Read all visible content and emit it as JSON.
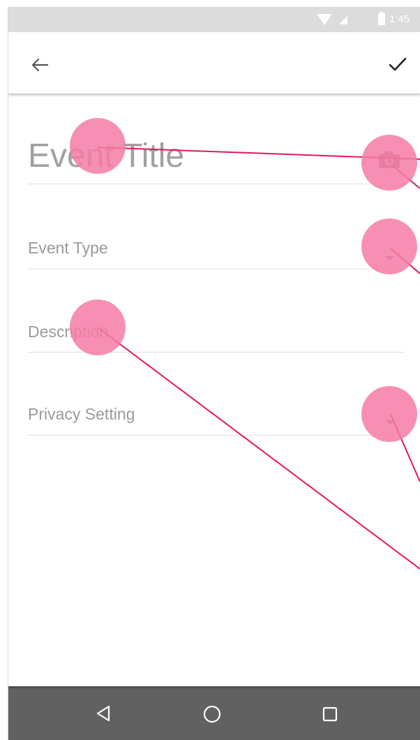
{
  "status_bar": {
    "time": "1:45"
  },
  "app_bar": {
    "back_icon": "arrow-left-icon",
    "confirm_icon": "check-icon"
  },
  "form": {
    "event_title_placeholder": "Event Title",
    "event_type_label": "Event Type",
    "description_label": "Description",
    "privacy_setting_label": "Privacy Setting",
    "camera_icon": "camera-icon",
    "dropdown_icon": "arrow-drop-down-icon"
  },
  "nav_bar": {
    "back_icon": "nav-back-icon",
    "home_icon": "nav-home-icon",
    "recents_icon": "nav-recents-icon"
  },
  "colors": {
    "accent_touch": "#f47ba6",
    "annotation_line": "#e0185c",
    "status_bar_bg": "#dcdcdc",
    "nav_bar_bg": "#616161"
  }
}
